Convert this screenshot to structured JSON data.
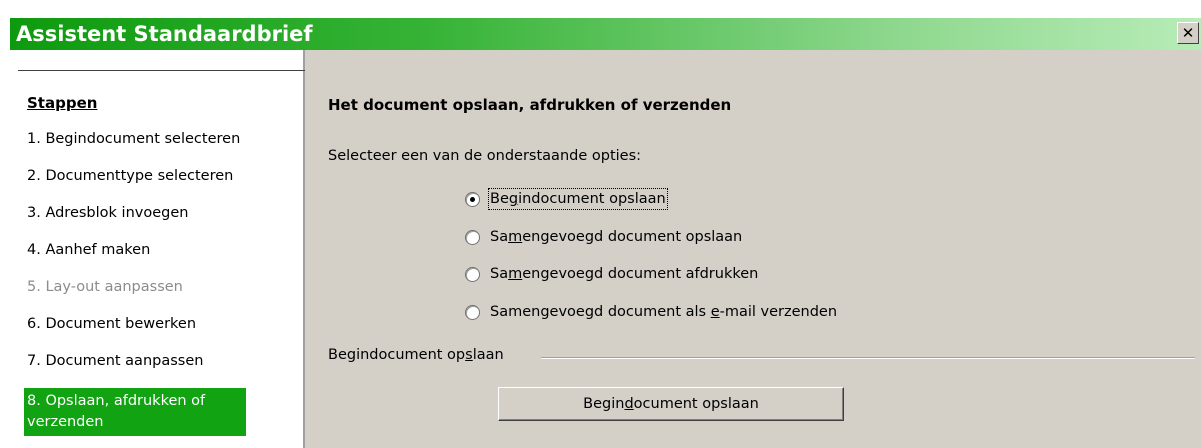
{
  "window": {
    "title": "Assistent Standaardbrief",
    "close_icon": "close-icon",
    "close_glyph": "✕"
  },
  "sidebar": {
    "heading": "Stappen",
    "steps": [
      {
        "label": "1. Begindocument selecteren",
        "state": "enabled"
      },
      {
        "label": "2. Documenttype selecteren",
        "state": "enabled"
      },
      {
        "label": "3. Adresblok invoegen",
        "state": "enabled"
      },
      {
        "label": "4. Aanhef maken",
        "state": "enabled"
      },
      {
        "label": "5. Lay-out aanpassen",
        "state": "disabled"
      },
      {
        "label": "6. Document bewerken",
        "state": "enabled"
      },
      {
        "label": "7. Document aanpassen",
        "state": "enabled"
      },
      {
        "label": "8. Opslaan, afdrukken of verzenden",
        "state": "active"
      }
    ]
  },
  "main": {
    "title": "Het document opslaan, afdrukken of verzenden",
    "instruction": "Selecteer een van de onderstaande opties:",
    "options": [
      {
        "pre": "Be",
        "mnemonic": "g",
        "post": "indocument opslaan",
        "checked": true
      },
      {
        "pre": "Sa",
        "mnemonic": "m",
        "post": "engevoegd document opslaan",
        "checked": false
      },
      {
        "pre": "Sa",
        "mnemonic": "m",
        "post": "engevoegd document afdrukken",
        "checked": false
      },
      {
        "pre": "Samengevoegd document als ",
        "mnemonic": "e",
        "post": "-mail verzenden",
        "checked": false
      }
    ],
    "section": {
      "pre": "Begindocument op",
      "mnemonic": "s",
      "post": "laan"
    },
    "action_button": {
      "pre": "Begin",
      "mnemonic": "d",
      "post": "ocument opslaan"
    }
  },
  "colors": {
    "title_gradient_start": "#0e9a0e",
    "title_gradient_end": "#b8ecb8",
    "active_step": "#11a311",
    "disabled_text": "#8c8c8c",
    "dialog_background": "#d4d0c8"
  }
}
